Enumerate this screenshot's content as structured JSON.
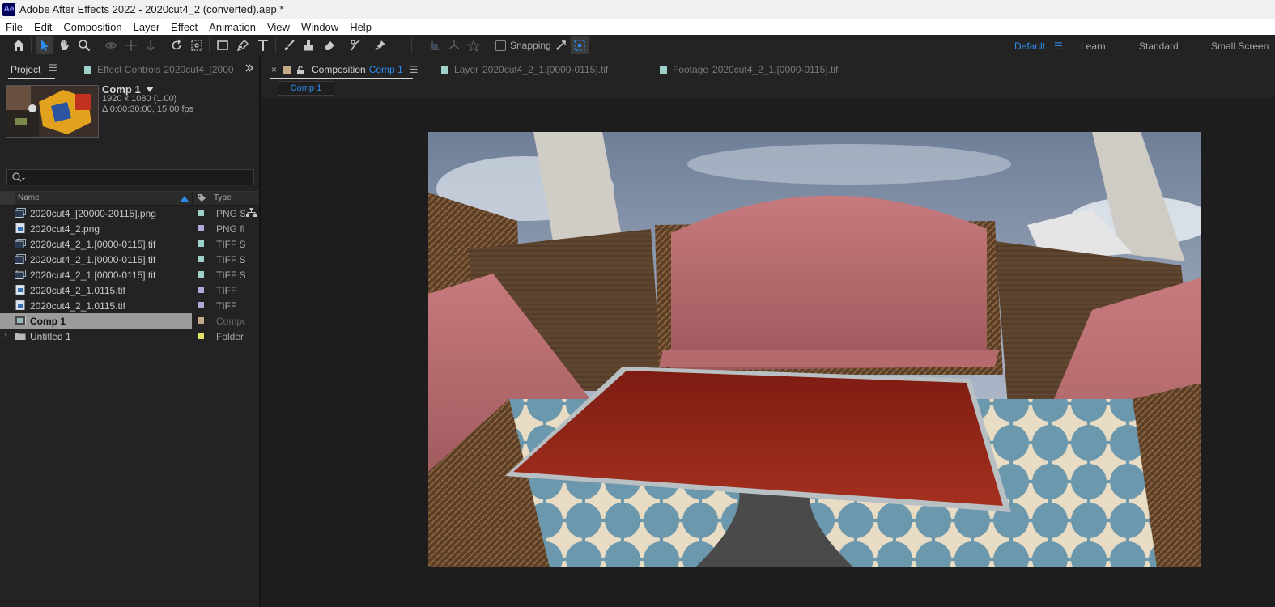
{
  "app": {
    "logo": "Ae",
    "title": "Adobe After Effects 2022 - 2020cut4_2 (converted).aep *"
  },
  "menu": [
    "File",
    "Edit",
    "Composition",
    "Layer",
    "Effect",
    "Animation",
    "View",
    "Window",
    "Help"
  ],
  "toolbar": {
    "tools": [
      "home-icon",
      "selection-tool-icon",
      "hand-tool-icon",
      "zoom-tool-icon",
      "orbit-camera-icon",
      "pan-camera-icon",
      "dolly-camera-icon",
      "rotate-tool-icon",
      "pan-behind-icon",
      "rectangle-tool-icon",
      "pen-tool-icon",
      "type-tool-icon",
      "brush-tool-icon",
      "clone-stamp-icon",
      "eraser-icon",
      "roto-brush-icon",
      "puppet-pin-icon",
      "local-axis-icon",
      "world-axis-icon",
      "view-axis-icon"
    ],
    "snapping_label": "Snapping",
    "workspaces": [
      {
        "label": "Default",
        "active": true
      },
      {
        "label": "Learn",
        "active": false
      },
      {
        "label": "Standard",
        "active": false
      },
      {
        "label": "Small Screen",
        "active": false
      }
    ],
    "menu_glyph": "☰"
  },
  "left_panel": {
    "tabs": {
      "project": "Project",
      "effect_controls_label": "Effect Controls",
      "effect_controls_target": "2020cut4_[2000"
    },
    "selected_item": {
      "name": "Comp 1",
      "dimensions": "1920 x 1080 (1.00)",
      "duration": "Δ 0:00:30:00, 15.00 fps"
    },
    "search": {
      "placeholder": ""
    },
    "columns": {
      "name": "Name",
      "type": "Type"
    },
    "items": [
      {
        "name": "2020cut4_[20000-20115].png",
        "type": "PNG Sequence",
        "icon": "image-sequence-icon",
        "label_color": "#9fd1cb"
      },
      {
        "name": "2020cut4_2.png",
        "type": "PNG file",
        "icon": "image-file-icon",
        "label_color": "#b3a6d8"
      },
      {
        "name": "2020cut4_2_1.[0000-0115].tif",
        "type": "TIFF Sequence",
        "icon": "image-sequence-icon",
        "label_color": "#9fd1cb"
      },
      {
        "name": "2020cut4_2_1.[0000-0115].tif",
        "type": "TIFF Sequence",
        "icon": "image-sequence-icon",
        "label_color": "#9fd1cb"
      },
      {
        "name": "2020cut4_2_1.[0000-0115].tif",
        "type": "TIFF Sequence",
        "icon": "image-sequence-icon",
        "label_color": "#9fd1cb"
      },
      {
        "name": "2020cut4_2_1.0115.tif",
        "type": "TIFF",
        "icon": "image-file-icon",
        "label_color": "#b3a6d8"
      },
      {
        "name": "2020cut4_2_1.0115.tif",
        "type": "TIFF",
        "icon": "image-file-icon",
        "label_color": "#b3a6d8"
      },
      {
        "name": "Comp 1",
        "type": "Composition",
        "icon": "composition-icon",
        "label_color": "#c4a88a",
        "selected": true
      },
      {
        "name": "Untitled 1",
        "type": "Folder",
        "icon": "folder-icon",
        "label_color": "#e3e36a"
      }
    ]
  },
  "right_panel": {
    "tabs": {
      "composition_label": "Composition",
      "composition_name": "Comp 1",
      "layer_label": "Layer",
      "layer_name": "2020cut4_2_1.[0000-0115].tif",
      "footage_label": "Footage",
      "footage_name": "2020cut4_2_1.[0000-0115].tif"
    },
    "active_comp_tab": "Comp 1"
  },
  "colors": {
    "accent": "#2d8ceb",
    "panel_bg": "#232323",
    "viewer_bg": "#1d1d1d",
    "comp_swatch": "#c4a88a",
    "footage_swatch": "#9fd1cb"
  }
}
